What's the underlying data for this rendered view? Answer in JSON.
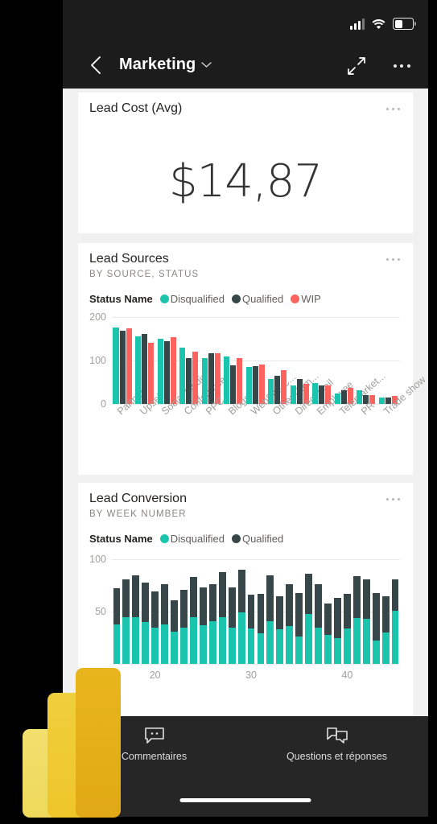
{
  "status_bar": {
    "signal": "signal-bars",
    "wifi": "wifi",
    "battery_level": 38
  },
  "nav": {
    "back": "back-arrow",
    "title": "Marketing",
    "chevron": "chevron-down",
    "expand": "expand-arrows",
    "more": "more-options"
  },
  "colors": {
    "teal": "#1bc5ad",
    "dark": "#374649",
    "coral": "#fd625e",
    "canvas_bg": "#f1f1f1",
    "card_bg": "#ffffff",
    "chrome": "#1c1c1c"
  },
  "cards": [
    {
      "title": "Lead Cost (Avg)",
      "subtitle": "",
      "value": "$14,87",
      "more": "more-options"
    },
    {
      "title": "Lead Sources",
      "subtitle": "BY SOURCE, STATUS",
      "more": "more-options"
    },
    {
      "title": "Lead Conversion",
      "subtitle": "BY WEEK NUMBER",
      "more": "more-options"
    }
  ],
  "legend_title": "Status Name",
  "chart_data": [
    {
      "type": "bar",
      "title": "Lead Sources",
      "subtitle": "BY SOURCE, STATUS",
      "xlabel": "",
      "ylabel": "",
      "ylim": [
        0,
        200
      ],
      "yticks": [
        0,
        100,
        200
      ],
      "grid": true,
      "legend_position": "top",
      "legend_title": "Status Name",
      "categories": [
        "Partner",
        "Upsell",
        "Social Media",
        "Conference",
        "PPC",
        "Blogs",
        "WebSite C...",
        "Other Cam...",
        "Direct Mail",
        "Employee",
        "Telemarket...",
        "PR",
        "Trade show"
      ],
      "series": [
        {
          "name": "Disqualified",
          "color": "#1bc5ad",
          "values": [
            176,
            155,
            150,
            129,
            105,
            109,
            85,
            57,
            42,
            49,
            25,
            31,
            15
          ]
        },
        {
          "name": "Qualified",
          "color": "#374649",
          "values": [
            169,
            161,
            145,
            105,
            116,
            88,
            87,
            65,
            57,
            43,
            31,
            21,
            14
          ]
        },
        {
          "name": "WIP",
          "color": "#fd625e",
          "values": [
            174,
            140,
            154,
            121,
            117,
            106,
            90,
            78,
            47,
            42,
            37,
            21,
            18
          ]
        }
      ]
    },
    {
      "type": "bar",
      "stacked": true,
      "title": "Lead Conversion",
      "subtitle": "BY WEEK NUMBER",
      "xlabel": "",
      "ylabel": "",
      "ylim": [
        0,
        100
      ],
      "yticks": [
        0,
        50,
        100
      ],
      "xticks": [
        20,
        30,
        40
      ],
      "grid": true,
      "legend_position": "top",
      "legend_title": "Status Name",
      "categories": [
        16,
        17,
        18,
        19,
        20,
        21,
        22,
        23,
        24,
        25,
        26,
        27,
        28,
        29,
        30,
        31,
        32,
        33,
        34,
        35,
        36,
        37,
        38,
        39,
        40,
        41,
        42,
        43,
        44,
        45
      ],
      "series": [
        {
          "name": "Disqualified",
          "color": "#1bc5ad",
          "values": [
            38,
            45,
            45,
            40,
            35,
            38,
            31,
            35,
            45,
            37,
            41,
            45,
            35,
            49,
            34,
            29,
            41,
            33,
            36,
            26,
            48,
            35,
            28,
            25,
            34,
            44,
            43,
            22,
            30,
            51
          ]
        },
        {
          "name": "Qualified",
          "color": "#374649",
          "values": [
            34,
            36,
            40,
            38,
            34,
            38,
            30,
            36,
            38,
            36,
            35,
            43,
            38,
            41,
            32,
            38,
            44,
            32,
            40,
            42,
            38,
            41,
            30,
            38,
            33,
            40,
            38,
            46,
            35,
            30
          ]
        }
      ]
    }
  ],
  "bottom_bar": [
    {
      "icon": "comment-icon",
      "label": "Commentaires"
    },
    {
      "icon": "qa-chat-icon",
      "label": "Questions et réponses"
    }
  ],
  "logo": "power-bi-logo"
}
